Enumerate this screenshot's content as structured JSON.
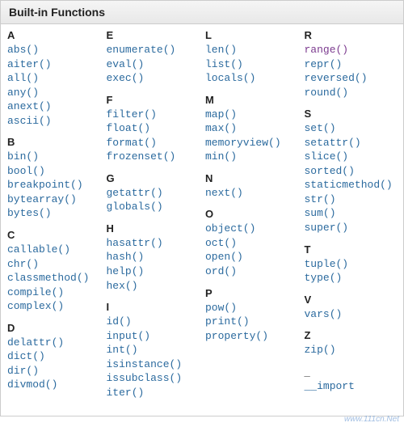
{
  "title": "Built-in Functions",
  "columns": [
    [
      {
        "letter": "A",
        "items": [
          "abs()",
          "aiter()",
          "all()",
          "any()",
          "anext()",
          "ascii()"
        ]
      },
      {
        "letter": "B",
        "items": [
          "bin()",
          "bool()",
          "breakpoint()",
          "bytearray()",
          "bytes()"
        ]
      },
      {
        "letter": "C",
        "items": [
          "callable()",
          "chr()",
          "classmethod()",
          "compile()",
          "complex()"
        ]
      },
      {
        "letter": "D",
        "items": [
          "delattr()",
          "dict()",
          "dir()",
          "divmod()"
        ]
      }
    ],
    [
      {
        "letter": "E",
        "items": [
          "enumerate()",
          "eval()",
          "exec()"
        ]
      },
      {
        "letter": "F",
        "items": [
          "filter()",
          "float()",
          "format()",
          "frozenset()"
        ]
      },
      {
        "letter": "G",
        "items": [
          "getattr()",
          "globals()"
        ]
      },
      {
        "letter": "H",
        "items": [
          "hasattr()",
          "hash()",
          "help()",
          "hex()"
        ]
      },
      {
        "letter": "I",
        "items": [
          "id()",
          "input()",
          "int()",
          "isinstance()",
          "issubclass()",
          "iter()"
        ]
      }
    ],
    [
      {
        "letter": "L",
        "items": [
          "len()",
          "list()",
          "locals()"
        ]
      },
      {
        "letter": "M",
        "items": [
          "map()",
          "max()",
          "memoryview()",
          "min()"
        ]
      },
      {
        "letter": "N",
        "items": [
          "next()"
        ]
      },
      {
        "letter": "O",
        "items": [
          "object()",
          "oct()",
          "open()",
          "ord()"
        ]
      },
      {
        "letter": "P",
        "items": [
          "pow()",
          "print()",
          "property()"
        ]
      }
    ],
    [
      {
        "letter": "R",
        "items": [
          "range()",
          "repr()",
          "reversed()",
          "round()"
        ],
        "purple": [
          "range()"
        ]
      },
      {
        "letter": "S",
        "items": [
          "set()",
          "setattr()",
          "slice()",
          "sorted()",
          "staticmethod()",
          "str()",
          "sum()",
          "super()"
        ]
      },
      {
        "letter": "T",
        "items": [
          "tuple()",
          "type()"
        ]
      },
      {
        "letter": "V",
        "items": [
          "vars()"
        ]
      },
      {
        "letter": "Z",
        "items": [
          "zip()"
        ]
      },
      {
        "letter": "_",
        "items": [
          "__import"
        ]
      }
    ]
  ],
  "watermark": "www.111cn.Net"
}
